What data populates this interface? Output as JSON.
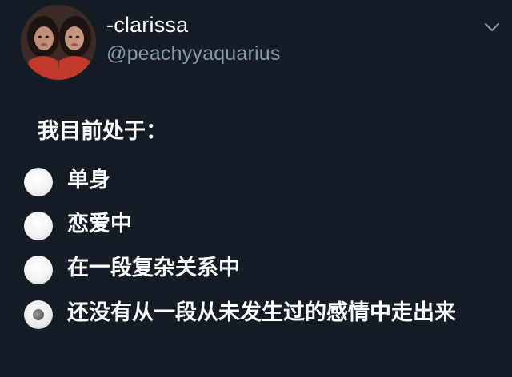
{
  "user": {
    "display_name": "-clarissa",
    "handle": "@peachyyaquarius"
  },
  "menu": {
    "icon": "chevron-down-icon"
  },
  "poll": {
    "question": "我目前处于：",
    "options": [
      {
        "label": "单身",
        "selected": false
      },
      {
        "label": "恋爱中",
        "selected": false
      },
      {
        "label": "在一段复杂关系中",
        "selected": false
      },
      {
        "label": "还没有从一段从未发生过的感情中走出来",
        "selected": true
      }
    ]
  },
  "colors": {
    "background": "#141d26",
    "text_primary": "#ffffff",
    "text_secondary": "#8899a6"
  }
}
